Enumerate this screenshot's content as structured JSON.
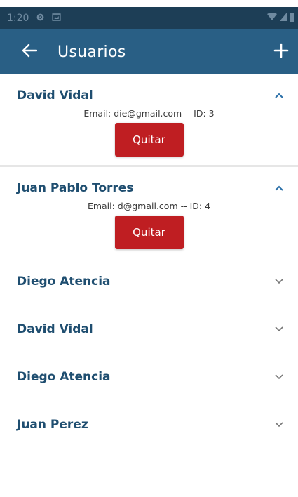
{
  "status_bar": {
    "time": "1:20"
  },
  "app_bar": {
    "title": "Usuarios",
    "back_icon": "arrow-left-icon",
    "add_icon": "plus-icon"
  },
  "users": [
    {
      "name": "David Vidal",
      "expanded": true,
      "info": "Email: die@gmail.com -- ID: 3",
      "remove_label": "Quitar"
    },
    {
      "name": "Juan Pablo Torres",
      "expanded": true,
      "info": "Email: d@gmail.com -- ID: 4",
      "remove_label": "Quitar"
    },
    {
      "name": "Diego Atencia",
      "expanded": false
    },
    {
      "name": "David Vidal",
      "expanded": false
    },
    {
      "name": "Diego Atencia",
      "expanded": false
    },
    {
      "name": "Juan Perez",
      "expanded": false
    }
  ],
  "colors": {
    "status_bar": "#1d3e56",
    "app_bar": "#295f85",
    "name_text": "#1f4e70",
    "remove_button": "#bf1e22"
  }
}
